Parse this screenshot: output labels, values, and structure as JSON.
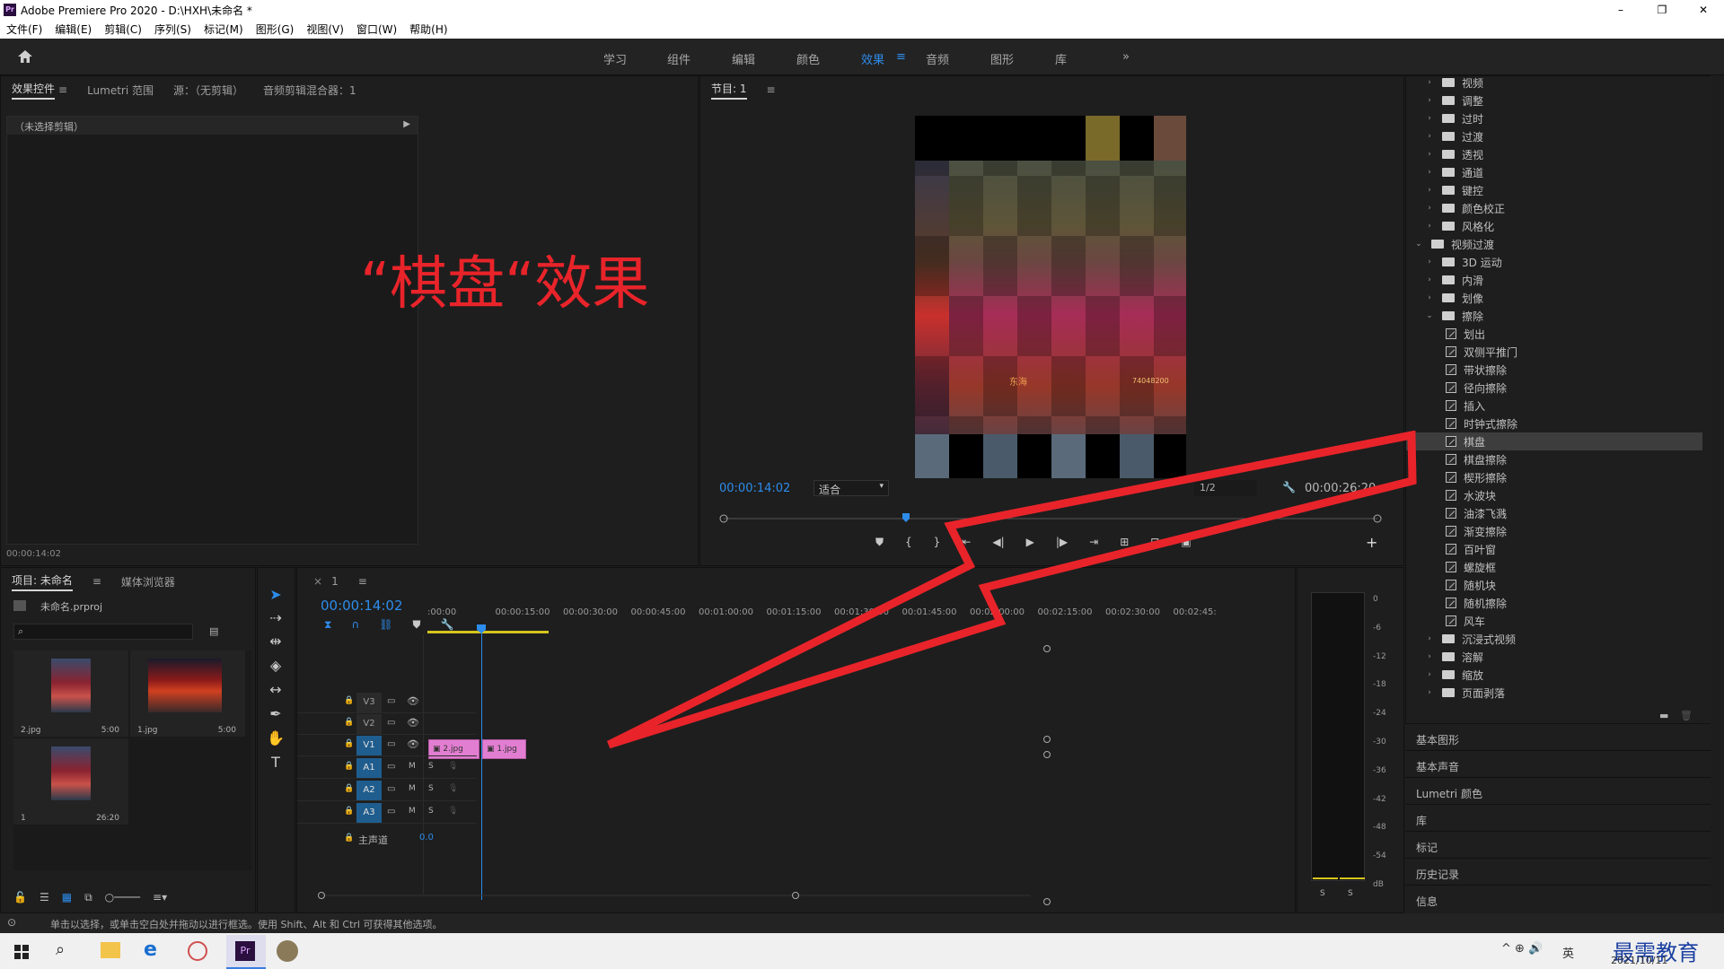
{
  "window": {
    "title": "Adobe Premiere Pro 2020 - D:\\HXH\\未命名 *",
    "minimize": "–",
    "maximize": "❐",
    "close": "✕"
  },
  "menu": [
    "文件(F)",
    "编辑(E)",
    "剪辑(C)",
    "序列(S)",
    "标记(M)",
    "图形(G)",
    "视图(V)",
    "窗口(W)",
    "帮助(H)"
  ],
  "workspaces": [
    "学习",
    "组件",
    "编辑",
    "颜色",
    "效果",
    "音频",
    "图形",
    "库"
  ],
  "workspace_more": "»",
  "source_panel": {
    "tabs": [
      "效果控件",
      "Lumetri 范围",
      "源：（无剪辑）",
      "音频剪辑混合器：1"
    ],
    "no_clip": "（未选择剪辑）",
    "timecode": "00:00:14:02"
  },
  "overlay_caption": "“棋盘“效果",
  "program": {
    "tab": "节目: 1",
    "timecode": "00:00:14:02",
    "fit": "适合",
    "resolution": "1/2",
    "duration": "00:00:26:20",
    "sign1": "东海",
    "sign2": "74048200"
  },
  "effects_tree": [
    {
      "label": "视频",
      "type": "folder",
      "level": 1,
      "partial": true
    },
    {
      "label": "调整",
      "type": "folder",
      "level": 1
    },
    {
      "label": "过时",
      "type": "folder",
      "level": 1
    },
    {
      "label": "过渡",
      "type": "folder",
      "level": 1
    },
    {
      "label": "透视",
      "type": "folder",
      "level": 1
    },
    {
      "label": "通道",
      "type": "folder",
      "level": 1
    },
    {
      "label": "键控",
      "type": "folder",
      "level": 1
    },
    {
      "label": "颜色校正",
      "type": "folder",
      "level": 1
    },
    {
      "label": "风格化",
      "type": "folder",
      "level": 1
    },
    {
      "label": "视频过渡",
      "type": "folder",
      "level": 0,
      "open": true
    },
    {
      "label": "3D 运动",
      "type": "folder",
      "level": 1
    },
    {
      "label": "内滑",
      "type": "folder",
      "level": 1
    },
    {
      "label": "划像",
      "type": "folder",
      "level": 1
    },
    {
      "label": "擦除",
      "type": "folder",
      "level": 1,
      "open": true
    },
    {
      "label": "划出",
      "type": "fx"
    },
    {
      "label": "双侧平推门",
      "type": "fx"
    },
    {
      "label": "带状擦除",
      "type": "fx"
    },
    {
      "label": "径向擦除",
      "type": "fx"
    },
    {
      "label": "插入",
      "type": "fx"
    },
    {
      "label": "时钟式擦除",
      "type": "fx"
    },
    {
      "label": "棋盘",
      "type": "fx",
      "selected": true
    },
    {
      "label": "棋盘擦除",
      "type": "fx"
    },
    {
      "label": "楔形擦除",
      "type": "fx"
    },
    {
      "label": "水波块",
      "type": "fx"
    },
    {
      "label": "油漆飞溅",
      "type": "fx"
    },
    {
      "label": "渐变擦除",
      "type": "fx"
    },
    {
      "label": "百叶窗",
      "type": "fx"
    },
    {
      "label": "螺旋框",
      "type": "fx"
    },
    {
      "label": "随机块",
      "type": "fx"
    },
    {
      "label": "随机擦除",
      "type": "fx"
    },
    {
      "label": "风车",
      "type": "fx"
    },
    {
      "label": "沉浸式视频",
      "type": "folder",
      "level": 1
    },
    {
      "label": "溶解",
      "type": "folder",
      "level": 1
    },
    {
      "label": "缩放",
      "type": "folder",
      "level": 1
    },
    {
      "label": "页面剥落",
      "type": "folder",
      "level": 1
    }
  ],
  "side_panels": [
    "基本图形",
    "基本声音",
    "Lumetri 颜色",
    "库",
    "标记",
    "历史记录",
    "信息"
  ],
  "project": {
    "tabs": [
      "项目: 未命名",
      "媒体浏览器"
    ],
    "file": "未命名.prproj",
    "items": [
      {
        "name": "2.jpg",
        "dur": "5:00"
      },
      {
        "name": "1.jpg",
        "dur": "5:00"
      },
      {
        "name": "1",
        "dur": "26:20"
      }
    ]
  },
  "timeline": {
    "tab": "1",
    "timecode": "00:00:14:02",
    "ruler": [
      ":00:00",
      "00:00:15:00",
      "00:00:30:00",
      "00:00:45:00",
      "00:01:00:00",
      "00:01:15:00",
      "00:01:30:00",
      "00:01:45:00",
      "00:02:00:00",
      "00:02:15:00",
      "00:02:30:00",
      "00:02:45:"
    ],
    "tracks": [
      {
        "id": "V3"
      },
      {
        "id": "V2"
      },
      {
        "id": "V1",
        "on": true
      },
      {
        "id": "A1",
        "on": true
      },
      {
        "id": "A2",
        "on": true
      },
      {
        "id": "A3",
        "on": true
      }
    ],
    "master": "主声道",
    "master_val": "0.0",
    "clip1": "2.jpg",
    "clip2": "1.jpg",
    "m": "M",
    "s": "S"
  },
  "vu_scale": [
    "0",
    "-6",
    "-12",
    "-18",
    "-24",
    "-30",
    "-36",
    "-42",
    "-48",
    "-54",
    "dB"
  ],
  "vu_s": "S",
  "status": "单击以选择，或单击空白处并拖动以进行框选。使用 Shift、Alt 和 Ctrl 可获得其他选项。",
  "tray": {
    "ime": "英",
    "date": "2021/10/11",
    "watermark": "最需教育"
  }
}
